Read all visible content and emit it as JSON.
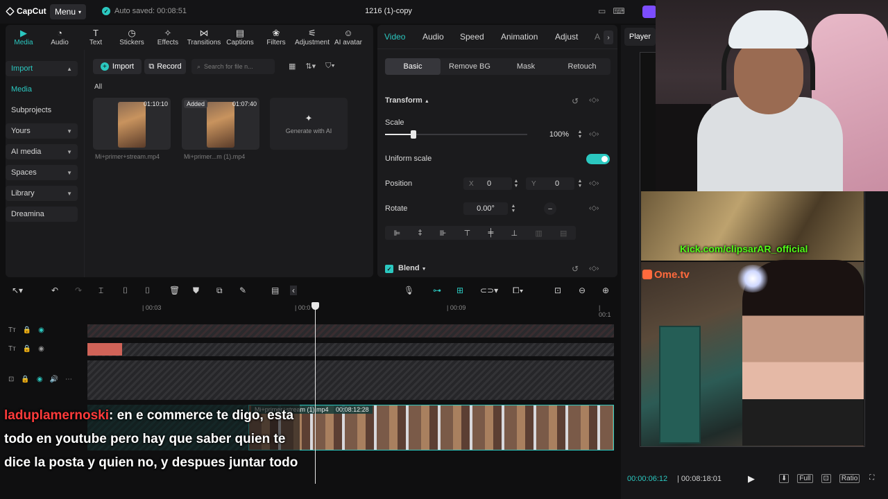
{
  "app": {
    "logo": "CapCut",
    "menu_label": "Menu",
    "autosave": "Auto saved: 00:08:51",
    "title": "1216 (1)-copy"
  },
  "toolbar": {
    "items": [
      {
        "label": "Media",
        "icon": "media-icon"
      },
      {
        "label": "Audio",
        "icon": "audio-icon"
      },
      {
        "label": "Text",
        "icon": "text-icon"
      },
      {
        "label": "Stickers",
        "icon": "stickers-icon"
      },
      {
        "label": "Effects",
        "icon": "effects-icon"
      },
      {
        "label": "Transitions",
        "icon": "transitions-icon"
      },
      {
        "label": "Captions",
        "icon": "captions-icon"
      },
      {
        "label": "Filters",
        "icon": "filters-icon"
      },
      {
        "label": "Adjustment",
        "icon": "adjustment-icon"
      },
      {
        "label": "AI avatar",
        "icon": "ai-avatar-icon"
      }
    ]
  },
  "sidebar": {
    "items": [
      {
        "label": "Import"
      },
      {
        "label": "Media"
      },
      {
        "label": "Subprojects"
      },
      {
        "label": "Yours"
      },
      {
        "label": "AI media"
      },
      {
        "label": "Spaces"
      },
      {
        "label": "Library"
      },
      {
        "label": "Dreamina"
      }
    ]
  },
  "media": {
    "import_label": "Import",
    "record_label": "Record",
    "search_placeholder": "Search for file n...",
    "all_label": "All",
    "items": [
      {
        "name": "Mi+primer+stream.mp4",
        "duration": "01:10:10",
        "badge": ""
      },
      {
        "name": "Mi+primer...m (1).mp4",
        "duration": "01:07:40",
        "badge": "Added"
      }
    ],
    "generate_label": "Generate with AI"
  },
  "inspector": {
    "tabs": [
      "Video",
      "Audio",
      "Speed",
      "Animation",
      "Adjust",
      "A"
    ],
    "subtabs": [
      "Basic",
      "Remove BG",
      "Mask",
      "Retouch"
    ],
    "transform_label": "Transform",
    "scale_label": "Scale",
    "scale_value": "100%",
    "scale_fraction": 0.2,
    "uniform_scale_label": "Uniform scale",
    "uniform_scale_on": true,
    "position_label": "Position",
    "pos_x_label": "X",
    "pos_x": "0",
    "pos_y_label": "Y",
    "pos_y": "0",
    "rotate_label": "Rotate",
    "rotate_value": "0.00°",
    "blend_label": "Blend"
  },
  "timeline": {
    "ticks": [
      "| 00:03",
      "| 00:0",
      "| 00:09",
      "| 00:1"
    ],
    "clip_label": "Mi+primer+stream (1).mp4",
    "clip_duration": "00:08:12:28"
  },
  "chat": {
    "user": "laduplamernoski",
    "message": ": en e commerce te digo, esta todo en youtube pero hay que saber quien te dice la posta y quien no, y despues juntar todo"
  },
  "player": {
    "tab_label": "Player",
    "kick_text": "Kick.com/clipsarAR_official",
    "ometv_text": "Ome.tv",
    "current_time": "00:00:06:12",
    "total_time": "00:08:18:01",
    "full_label": "Full",
    "ratio_label": "Ratio"
  },
  "colors": {
    "accent": "#2bc8c0",
    "chat_user": "#ff3b3b",
    "kick_green": "#53fc18"
  }
}
